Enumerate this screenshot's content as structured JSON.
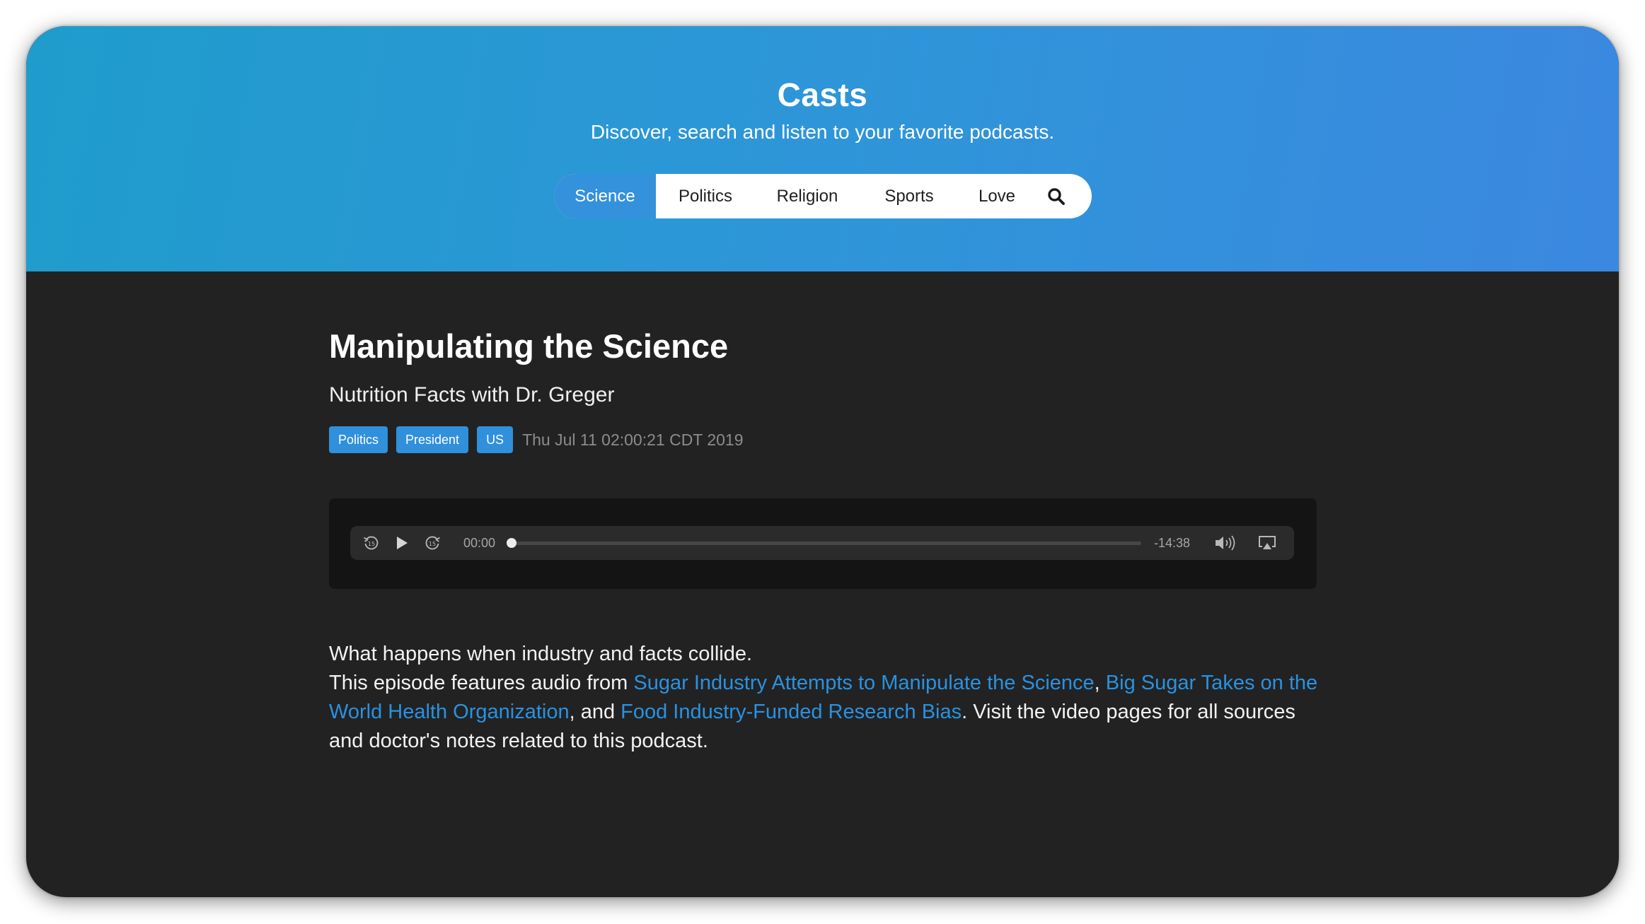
{
  "header": {
    "title": "Casts",
    "subtitle": "Discover, search and listen to your favorite podcasts."
  },
  "nav": {
    "tabs": [
      {
        "label": "Science",
        "active": true
      },
      {
        "label": "Politics",
        "active": false
      },
      {
        "label": "Religion",
        "active": false
      },
      {
        "label": "Sports",
        "active": false
      },
      {
        "label": "Love",
        "active": false
      }
    ],
    "search_icon": "search-icon"
  },
  "episode": {
    "title": "Manipulating the Science",
    "show": "Nutrition Facts with Dr. Greger",
    "tags": [
      "Politics",
      "President",
      "US"
    ],
    "date": "Thu Jul 11 02:00:21 CDT 2019"
  },
  "player": {
    "elapsed": "00:00",
    "remaining": "-14:38",
    "progress": 0.0,
    "icons": [
      "skip-back-15-icon",
      "play-icon",
      "skip-forward-15-icon",
      "volume-icon",
      "airplay-icon"
    ]
  },
  "description": {
    "line1": "What happens when industry and facts collide.",
    "intro": "This episode features audio from ",
    "link1": "Sugar Industry Attempts to Manipulate the Science",
    "sep1": ", ",
    "link2": "Big Sugar Takes on the World Health Organization",
    "sep2": ", and ",
    "link3": "Food Industry-Funded Research Bias",
    "outro": ". Visit the video pages for all sources and doctor's notes related to this podcast."
  },
  "colors": {
    "accent": "#3491db",
    "link": "#2a92e0",
    "background": "#222223",
    "tag": "#3090dc"
  }
}
